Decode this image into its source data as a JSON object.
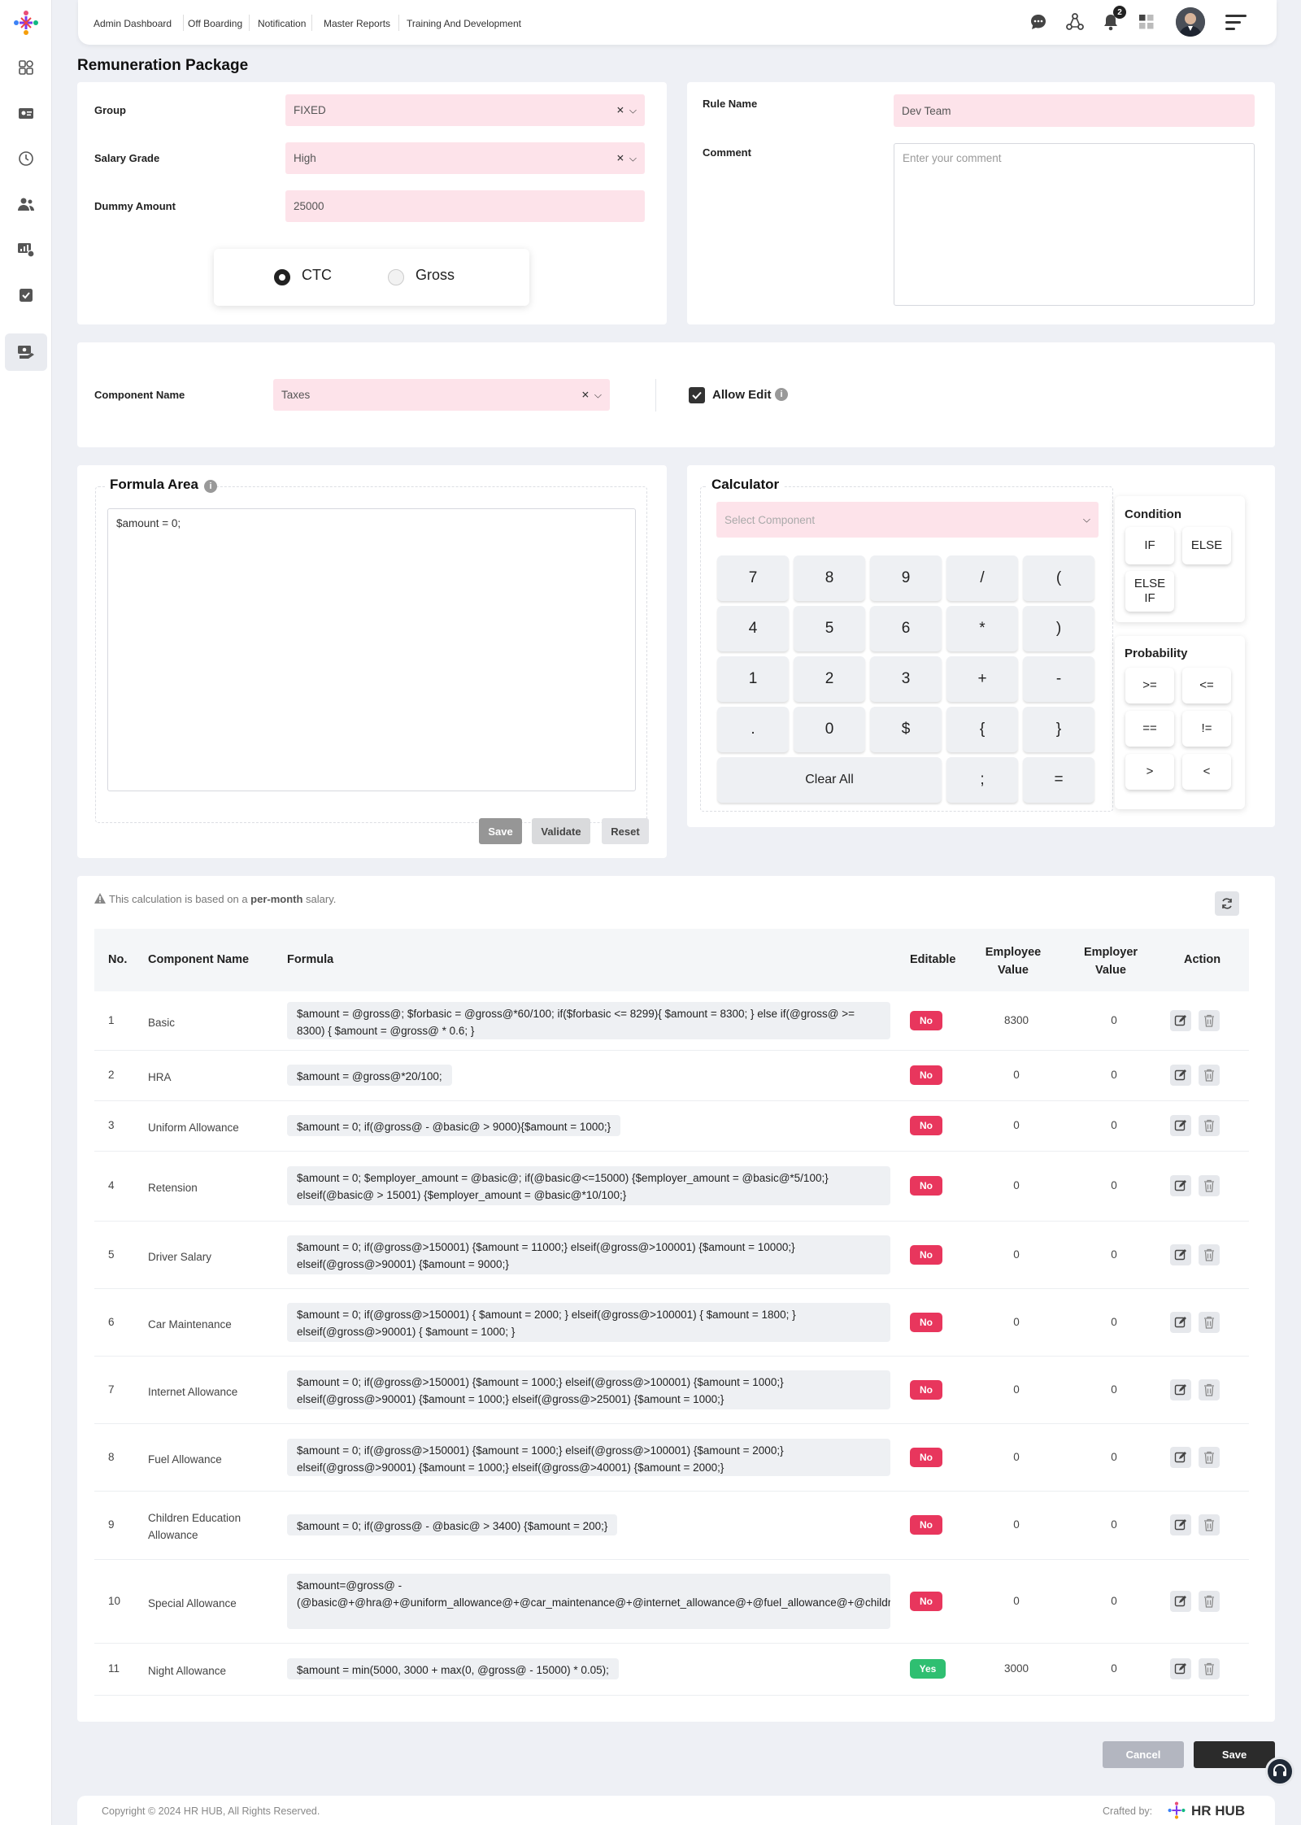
{
  "topnav": {
    "links": [
      "Admin Dashboard",
      "Off Boarding",
      "Notification",
      "Master Reports",
      "Training And Development"
    ],
    "notification_count": "2"
  },
  "page": {
    "title": "Remuneration Package"
  },
  "form": {
    "group_label": "Group",
    "group_value": "FIXED",
    "salary_grade_label": "Salary Grade",
    "salary_grade_value": "High",
    "dummy_amount_label": "Dummy Amount",
    "dummy_amount_value": "25000",
    "rule_name_label": "Rule Name",
    "rule_name_value": "Dev Team",
    "comment_label": "Comment",
    "comment_placeholder": "Enter your comment",
    "radio": {
      "ctc_label": "CTC",
      "gross_label": "Gross",
      "selected": "CTC"
    }
  },
  "component": {
    "label": "Component Name",
    "value": "Taxes",
    "allow_edit_label": "Allow Edit",
    "allow_edit_checked": true
  },
  "formula_area": {
    "title": "Formula Area",
    "value": "$amount = 0;",
    "save": "Save",
    "validate": "Validate",
    "reset": "Reset"
  },
  "calculator": {
    "title": "Calculator",
    "select_placeholder": "Select Component",
    "keys": [
      [
        "7",
        "8",
        "9",
        "/",
        "("
      ],
      [
        "4",
        "5",
        "6",
        "*",
        ")"
      ],
      [
        "1",
        "2",
        "3",
        "+",
        "-"
      ],
      [
        ".",
        "0",
        "$",
        "{",
        "}"
      ]
    ],
    "clear_all": "Clear All",
    "semicolon": ";",
    "equals": "=",
    "condition_title": "Condition",
    "condition_keys": [
      "IF",
      "ELSE",
      "ELSE IF"
    ],
    "probability_title": "Probability",
    "probability_keys": [
      ">=",
      "<=",
      "==",
      "!=",
      ">",
      "<"
    ]
  },
  "table": {
    "note_pre": "This calculation is based on a ",
    "note_bold": "per-month",
    "note_post": " salary.",
    "headers": {
      "no": "No.",
      "name": "Component Name",
      "formula": "Formula",
      "editable": "Editable",
      "employee": "Employee Value",
      "employer": "Employer Value",
      "action": "Action"
    },
    "rows": [
      {
        "no": "1",
        "name": "Basic",
        "formula": "$amount = @gross@; $forbasic = @gross@*60/100; if($forbasic <= 8299){ $amount = 8300; } else if(@gross@ >= 8300) { $amount = @gross@ * 0.6; }",
        "editable": "No",
        "employee": "8300",
        "employer": "0"
      },
      {
        "no": "2",
        "name": "HRA",
        "formula": "$amount = @gross@*20/100;",
        "editable": "No",
        "employee": "0",
        "employer": "0"
      },
      {
        "no": "3",
        "name": "Uniform Allowance",
        "formula": "$amount = 0; if(@gross@ - @basic@ > 9000){$amount = 1000;}",
        "editable": "No",
        "employee": "0",
        "employer": "0"
      },
      {
        "no": "4",
        "name": "Retension",
        "formula": "$amount = 0; $employer_amount = @basic@; if(@basic@<=15000) {$employer_amount = @basic@*5/100;} elseif(@basic@ > 15001) {$employer_amount = @basic@*10/100;}",
        "editable": "No",
        "employee": "0",
        "employer": "0"
      },
      {
        "no": "5",
        "name": "Driver Salary",
        "formula": "$amount = 0; if(@gross@>150001) {$amount = 11000;} elseif(@gross@>100001) {$amount = 10000;} elseif(@gross@>90001) {$amount = 9000;}",
        "editable": "No",
        "employee": "0",
        "employer": "0"
      },
      {
        "no": "6",
        "name": "Car Maintenance",
        "formula": "$amount = 0; if(@gross@>150001) { $amount = 2000; } elseif(@gross@>100001) { $amount = 1800; } elseif(@gross@>90001) { $amount = 1000; }",
        "editable": "No",
        "employee": "0",
        "employer": "0"
      },
      {
        "no": "7",
        "name": "Internet Allowance",
        "formula": "$amount = 0; if(@gross@>150001) {$amount = 1000;} elseif(@gross@>100001) {$amount = 1000;} elseif(@gross@>90001) {$amount = 1000;} elseif(@gross@>25001) {$amount = 1000;}",
        "editable": "No",
        "employee": "0",
        "employer": "0"
      },
      {
        "no": "8",
        "name": "Fuel Allowance",
        "formula": "$amount = 0; if(@gross@>150001) {$amount = 1000;} elseif(@gross@>100001) {$amount = 2000;} elseif(@gross@>90001) {$amount = 1000;} elseif(@gross@>40001) {$amount = 2000;}",
        "editable": "No",
        "employee": "0",
        "employer": "0"
      },
      {
        "no": "9",
        "name": "Children Education Allowance",
        "formula": "$amount = 0; if(@gross@ - @basic@ > 3400) {$amount = 200;}",
        "editable": "No",
        "employee": "0",
        "employer": "0"
      },
      {
        "no": "10",
        "name": "Special Allowance",
        "formula": "$amount=@gross@ - (@basic@+@hra@+@uniform_allowance@+@car_maintenance@+@internet_allowance@+@fuel_allowance@+@children_education_allowance@+@driver_salary@);",
        "editable": "No",
        "employee": "0",
        "employer": "0"
      },
      {
        "no": "11",
        "name": "Night Allowance",
        "formula": "$amount = min(5000, 3000 + max(0, @gross@ - 15000) * 0.05);",
        "editable": "Yes",
        "employee": "3000",
        "employer": "0"
      }
    ]
  },
  "footer_buttons": {
    "cancel": "Cancel",
    "save": "Save"
  },
  "footer": {
    "copyright": "Copyright © 2024 HR HUB, All Rights Reserved.",
    "crafted_by": "Crafted by:",
    "brand": "HR HUB"
  },
  "colors": {
    "pink_field": "#fde3ea",
    "badge_no": "#e8365d",
    "badge_yes": "#2fbf71",
    "primary_dark": "#2b2b2b"
  }
}
